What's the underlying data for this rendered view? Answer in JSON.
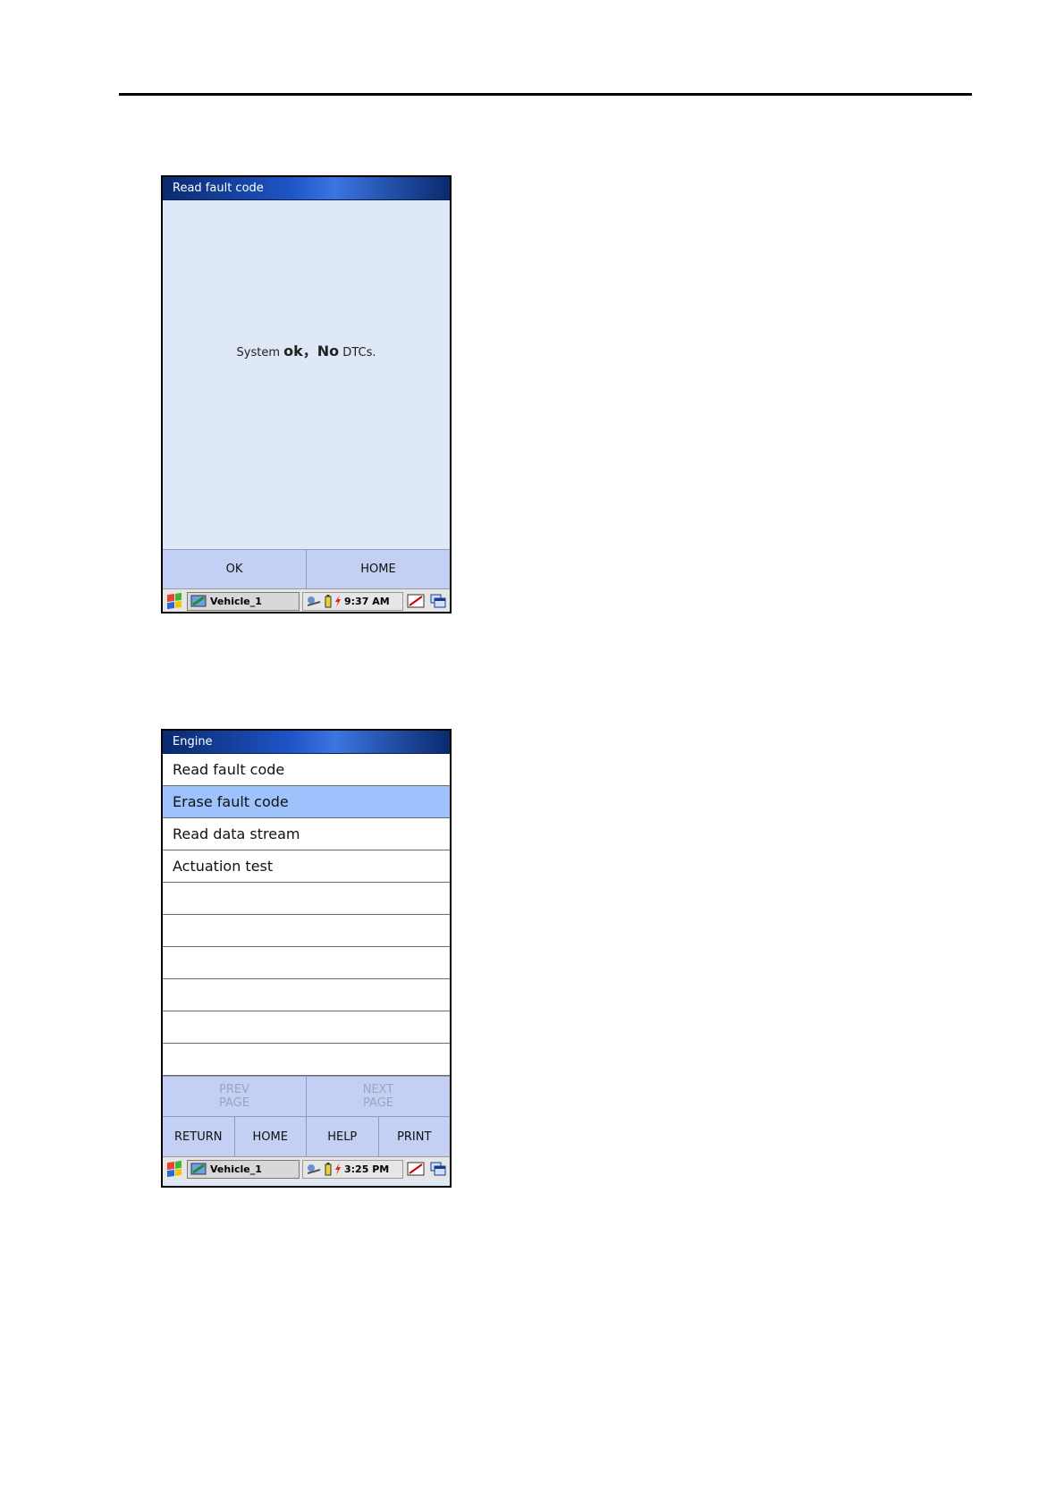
{
  "screen1": {
    "title": "Read fault code",
    "message": {
      "part1": "System ",
      "part2": "ok",
      "part3": "，",
      "part4": "No",
      "part5": " DTCs."
    },
    "buttons": [
      "OK",
      "HOME"
    ],
    "taskbar": {
      "task": "Vehicle_1",
      "time": "9:37 AM"
    }
  },
  "screen2": {
    "title": "Engine",
    "items": [
      "Read fault code",
      "Erase fault code",
      "Read data stream",
      "Actuation test",
      "",
      "",
      "",
      "",
      "",
      ""
    ],
    "selected_index": 1,
    "paging": {
      "prev_line1": "PREV",
      "prev_line2": "PAGE",
      "next_line1": "NEXT",
      "next_line2": "PAGE"
    },
    "buttons": [
      "RETURN",
      "HOME",
      "HELP",
      "PRINT"
    ],
    "taskbar": {
      "task": "Vehicle_1",
      "time": "3:25 PM"
    }
  },
  "colors": {
    "title_blue": "#1f55c8",
    "panel": "#dfe8f6",
    "button": "#c3d0f3",
    "selected": "#9dc2fc"
  },
  "icons": [
    "windows-start-icon",
    "vehicle-app-icon",
    "connection-icon",
    "battery-icon",
    "power-icon",
    "pen-input-icon",
    "window-switch-icon"
  ]
}
